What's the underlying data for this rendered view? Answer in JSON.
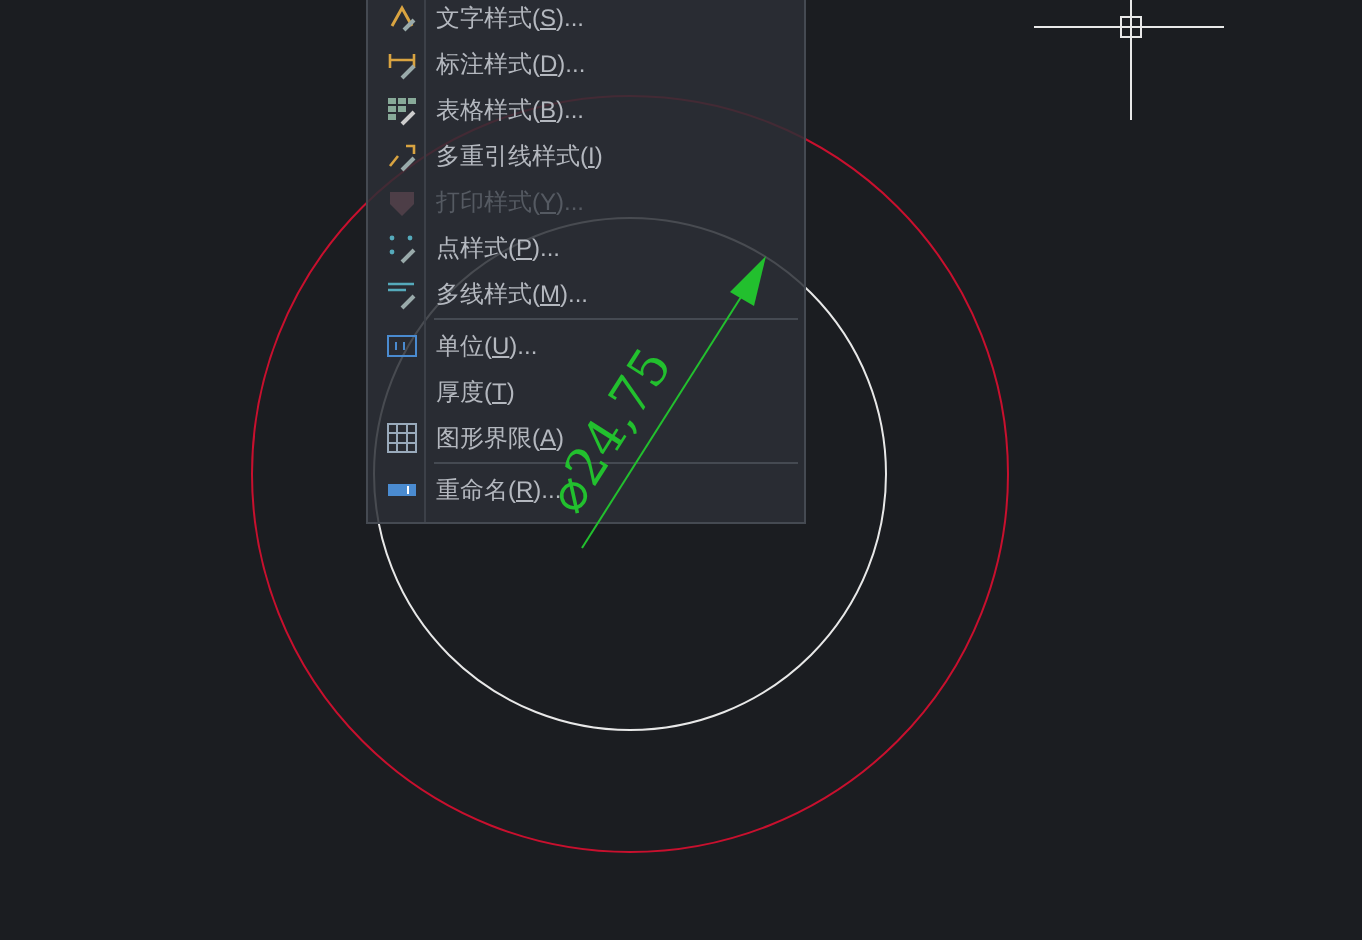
{
  "canvas": {
    "dimension_text": "⌀24,75"
  },
  "menu": {
    "items": [
      {
        "kind": "item",
        "before": "文字样式(",
        "key": "S",
        "after": ")...",
        "disabled": false
      },
      {
        "kind": "item",
        "before": "标注样式(",
        "key": "D",
        "after": ")...",
        "disabled": false
      },
      {
        "kind": "item",
        "before": "表格样式(",
        "key": "B",
        "after": ")...",
        "disabled": false
      },
      {
        "kind": "item",
        "before": "多重引线样式(",
        "key": "I",
        "after": ")",
        "disabled": false
      },
      {
        "kind": "item",
        "before": "打印样式(",
        "key": "Y",
        "after": ")...",
        "disabled": true
      },
      {
        "kind": "item",
        "before": "点样式(",
        "key": "P",
        "after": ")...",
        "disabled": false
      },
      {
        "kind": "item",
        "before": "多线样式(",
        "key": "M",
        "after": ")...",
        "disabled": false
      },
      {
        "kind": "separator"
      },
      {
        "kind": "item",
        "before": "单位(",
        "key": "U",
        "after": ")...",
        "disabled": false
      },
      {
        "kind": "item",
        "before": "厚度(",
        "key": "T",
        "after": ")",
        "disabled": false
      },
      {
        "kind": "item",
        "before": "图形界限(",
        "key": "A",
        "after": ")",
        "disabled": false
      },
      {
        "kind": "separator"
      },
      {
        "kind": "item",
        "before": "重命名(",
        "key": "R",
        "after": ")...",
        "disabled": false
      }
    ]
  }
}
